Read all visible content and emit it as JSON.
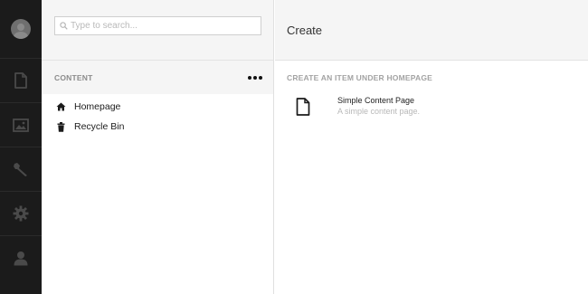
{
  "search": {
    "placeholder": "Type to search..."
  },
  "tree": {
    "section_title": "CONTENT",
    "items": [
      {
        "label": "Homepage",
        "icon": "home-icon"
      },
      {
        "label": "Recycle Bin",
        "icon": "trash-icon"
      }
    ]
  },
  "rail": {
    "items": [
      "document-icon",
      "image-icon",
      "wrench-icon",
      "gear-icon",
      "user-icon"
    ]
  },
  "main": {
    "title": "Create",
    "subheading": "CREATE AN ITEM UNDER HOMEPAGE",
    "doctypes": [
      {
        "name": "Simple Content Page",
        "description": "A simple content page.",
        "icon": "document-icon"
      }
    ]
  },
  "colors": {
    "rail_bg": "#1b1b1b",
    "rail_icon": "#4a4a4a",
    "panel_header_bg": "#f5f5f5"
  }
}
